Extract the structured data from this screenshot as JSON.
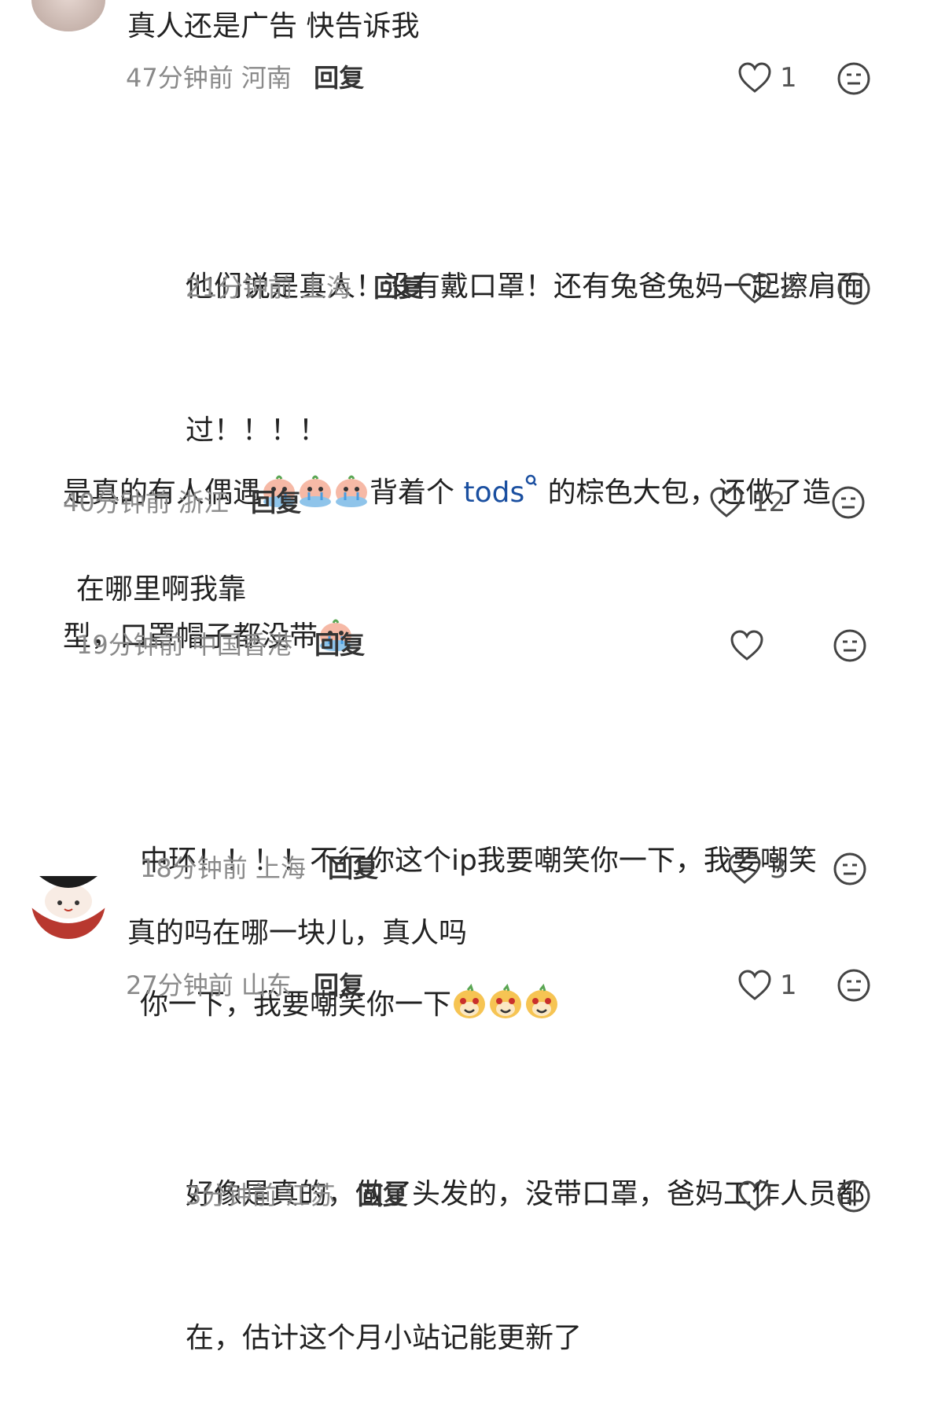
{
  "comments": [
    {
      "text": "真人还是广告 快告诉我",
      "time": "47分钟前",
      "loc": "河南",
      "reply": "回复",
      "likes": "1"
    },
    {
      "text_line1": "他们说是真人！没有戴口罩！还有兔爸兔妈一起擦肩而",
      "text_line2": "过！！！！",
      "time": "21分钟前",
      "loc": "上海",
      "reply": "回复",
      "likes": "2"
    },
    {
      "text_a": "是真的有人偶遇",
      "text_b": "背着个",
      "link": "tods",
      "text_c": " 的棕色大包，还做了造",
      "text_line2": "型，口罩帽子都没带",
      "time": "40分钟前",
      "loc": "浙江",
      "reply": "回复",
      "likes": "12"
    },
    {
      "text": "在哪里啊我靠",
      "time": "19分钟前",
      "loc": "中国香港",
      "reply": "回复",
      "likes": ""
    },
    {
      "text_line1": "中环！！！！不行你这个ip我要嘲笑你一下，我要嘲笑",
      "text_line2": "你一下，我要嘲笑你一下",
      "time": "18分钟前",
      "loc": "上海",
      "reply": "回复",
      "likes": "3"
    },
    {
      "text": "真的吗在哪一块儿，真人吗",
      "time": "27分钟前",
      "loc": "山东",
      "reply": "回复",
      "likes": "1"
    },
    {
      "text_line1": "好像是真的，做了头发的，没带口罩，爸妈工作人员都",
      "text_line2": "在，估计这个月小站记能更新了",
      "time": "3分钟前",
      "loc": "江苏",
      "reply": "回复",
      "likes": ""
    }
  ],
  "colors": {
    "text": "#222222",
    "meta": "#8a8a8a",
    "link": "#1a4fa0",
    "icon": "#555555"
  },
  "icons": {
    "like": "heart-outline-icon",
    "dislike": "neutral-face-icon",
    "emoji_cry": "crying-face-emoji",
    "emoji_laugh": "laughing-face-emoji",
    "search_hint": "search-icon"
  }
}
